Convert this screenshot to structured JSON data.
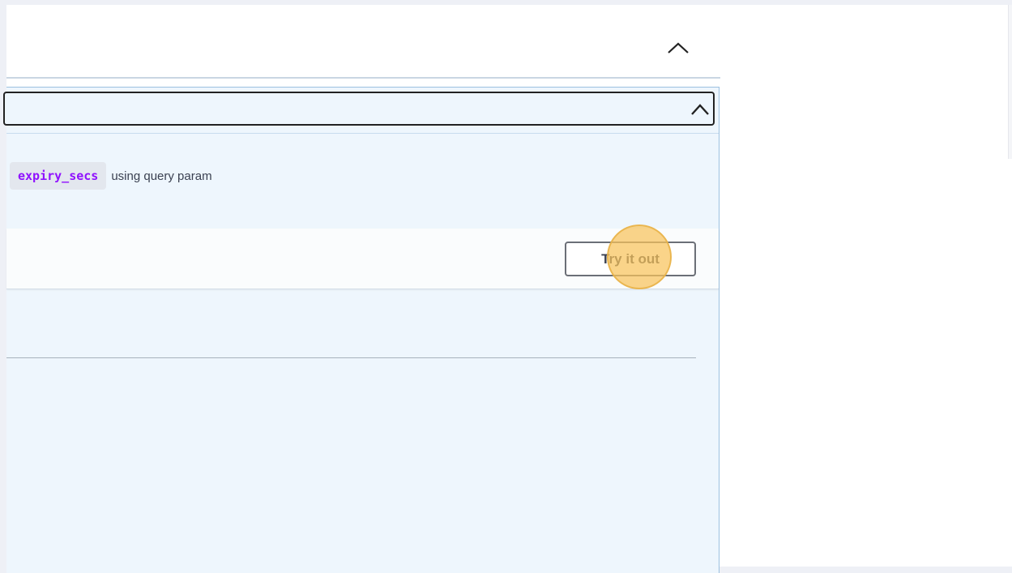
{
  "operation": {
    "description": {
      "param_code": "expiry_secs",
      "param_text": "using query param"
    },
    "try_it_out_label": "Try it out"
  },
  "colors": {
    "code_text": "#9012fe",
    "op_background": "#eef6fd",
    "op_border": "#9cc0e0",
    "highlight": "#f8c45c"
  },
  "icons": {
    "section_collapse": "chevron-up-icon",
    "operation_collapse": "chevron-up-icon"
  }
}
